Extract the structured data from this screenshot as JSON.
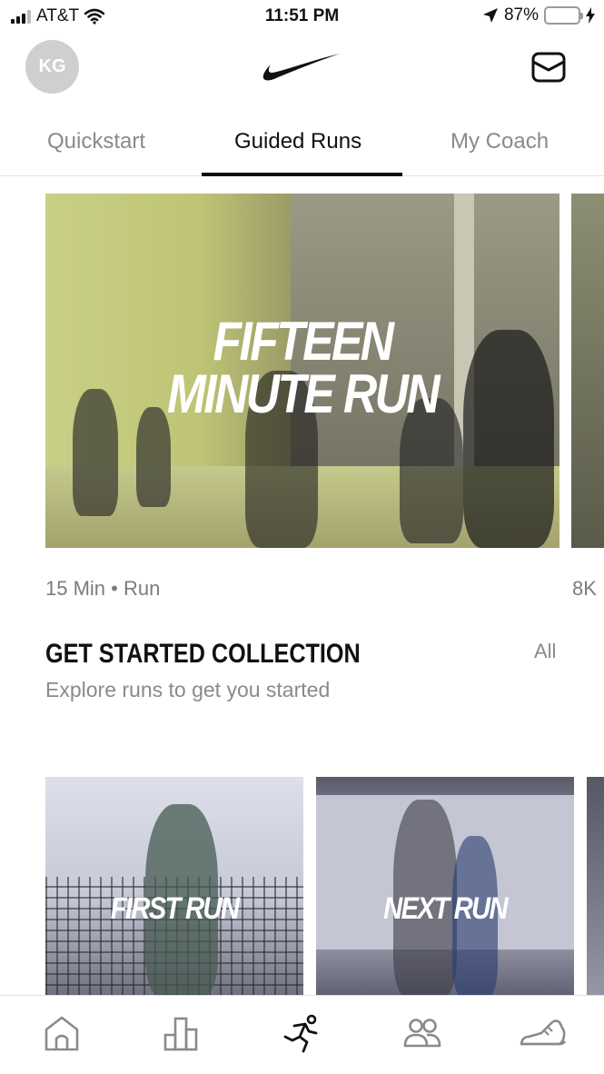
{
  "status_bar": {
    "carrier": "AT&T",
    "time": "11:51 PM",
    "battery_percent": "87%",
    "battery_level": 0.87,
    "icons": [
      "signal-icon",
      "wifi-icon",
      "location-arrow-icon",
      "battery-icon",
      "charging-bolt-icon"
    ]
  },
  "header": {
    "avatar_initials": "KG",
    "logo_icon": "nike-swoosh-icon",
    "inbox_icon": "inbox-icon"
  },
  "tabs": [
    {
      "label": "Quickstart",
      "active": false
    },
    {
      "label": "Guided Runs",
      "active": true
    },
    {
      "label": "My Coach",
      "active": false
    }
  ],
  "featured": {
    "title_line1": "FIFTEEN",
    "title_line2": "MINUTE RUN",
    "meta": "15 Min • Run",
    "next_meta": "8K"
  },
  "collection": {
    "title": "GET STARTED COLLECTION",
    "subtitle": "Explore runs to get you started",
    "all_label": "All",
    "cards": [
      {
        "title": "FIRST RUN"
      },
      {
        "title": "NEXT RUN"
      }
    ]
  },
  "tabbar": {
    "items": [
      {
        "icon": "home-icon",
        "active": false
      },
      {
        "icon": "activity-chart-icon",
        "active": false
      },
      {
        "icon": "runner-icon",
        "active": true
      },
      {
        "icon": "community-icon",
        "active": false
      },
      {
        "icon": "shoe-icon",
        "active": false
      }
    ]
  },
  "colors": {
    "active": "#111111",
    "inactive": "#8a8a8a",
    "battery_fill": "#4cd964"
  }
}
